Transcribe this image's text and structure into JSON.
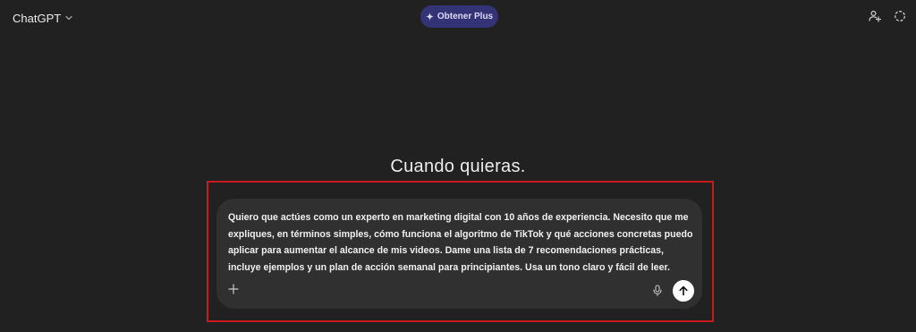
{
  "header": {
    "model_name": "ChatGPT",
    "model_chevron_icon": "chevron-down-icon",
    "upgrade_label": "Obtener Plus",
    "upgrade_icon": "sparkle-icon",
    "profile_icon": "add-user-icon",
    "temporary_chat_icon": "dashed-circle-icon",
    "upgrade_color": "#353377"
  },
  "main": {
    "headline": "Cuando quieras.",
    "highlight_color": "#c8191d"
  },
  "composer": {
    "text": "Quiero que actúes como un experto en marketing digital con 10 años de experiencia. Necesito que me expliques, en términos simples, cómo funciona el algoritmo de TikTok y qué acciones concretas puedo aplicar para aumentar el alcance de mis videos. Dame una lista de 7 recomendaciones prácticas, incluye ejemplos y un plan de acción semanal para principiantes. Usa un tono claro y fácil de leer.",
    "add_icon": "plus-icon",
    "mic_icon": "microphone-icon",
    "send_icon": "arrow-up-icon",
    "background": "#303030"
  }
}
